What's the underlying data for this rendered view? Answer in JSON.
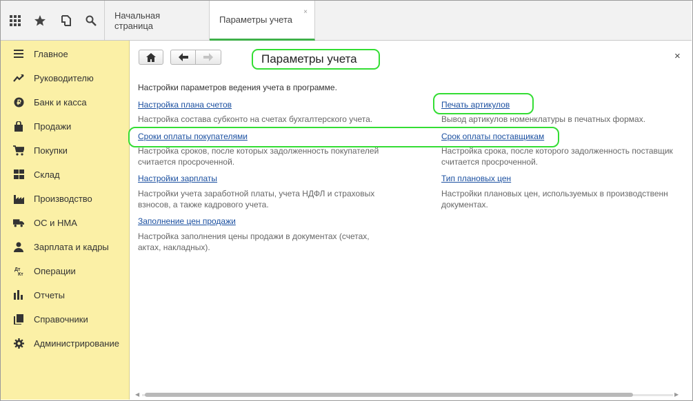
{
  "topbar": {
    "icons": [
      "apps-grid-icon",
      "star-icon",
      "history-icon",
      "search-icon"
    ],
    "tabs": [
      {
        "label": "Начальная страница"
      },
      {
        "label": "Параметры учета",
        "close": "×"
      }
    ]
  },
  "sidebar": {
    "items": [
      {
        "label": "Главное",
        "icon": "menu-lines-icon"
      },
      {
        "label": "Руководителю",
        "icon": "trend-icon"
      },
      {
        "label": "Банк и касса",
        "icon": "ruble-coin-icon"
      },
      {
        "label": "Продажи",
        "icon": "shopping-bag-icon"
      },
      {
        "label": "Покупки",
        "icon": "cart-icon"
      },
      {
        "label": "Склад",
        "icon": "warehouse-grid-icon"
      },
      {
        "label": "Производство",
        "icon": "factory-icon"
      },
      {
        "label": "ОС и НМА",
        "icon": "truck-icon"
      },
      {
        "label": "Зарплата и кадры",
        "icon": "person-icon"
      },
      {
        "label": "Операции",
        "icon": "operations-icon"
      },
      {
        "label": "Отчеты",
        "icon": "bar-chart-icon"
      },
      {
        "label": "Справочники",
        "icon": "books-icon"
      },
      {
        "label": "Администрирование",
        "icon": "gear-icon"
      }
    ]
  },
  "main": {
    "title": "Параметры учета",
    "close": "×",
    "description": "Настройки параметров ведения учета в программе.",
    "left_links": [
      {
        "label": "Настройка плана счетов",
        "note": [
          "Настройка состава субконто на счетах бухгалтерского учета."
        ]
      },
      {
        "label": "Сроки оплаты покупателями",
        "note": [
          "Настройка сроков, после которых задолженность покупателей",
          "считается просроченной."
        ]
      },
      {
        "label": "Настройки зарплаты",
        "note": [
          "Настройки учета заработной платы, учета НДФЛ и страховых",
          "взносов, а также кадрового учета."
        ]
      },
      {
        "label": "Заполнение цен продажи",
        "note": [
          "Настройка заполнения цены продажи в документах (счетах,",
          "актах, накладных)."
        ]
      }
    ],
    "right_links": [
      {
        "label": "Печать артикулов",
        "note": [
          "Вывод артикулов номенклатуры в печатных формах."
        ]
      },
      {
        "label": "Срок оплаты поставщикам",
        "note": [
          "Настройка срока, после которого задолженность поставщик",
          "считается просроченной."
        ]
      },
      {
        "label": "Тип плановых цен",
        "note": [
          "Настройки плановых цен, используемых в производственн",
          "документах."
        ]
      }
    ]
  },
  "colors": {
    "sidebar_bg": "#fbf0a6",
    "accent_green": "#3fb049",
    "highlight": "#33dd33",
    "link": "#1a4fa0"
  }
}
